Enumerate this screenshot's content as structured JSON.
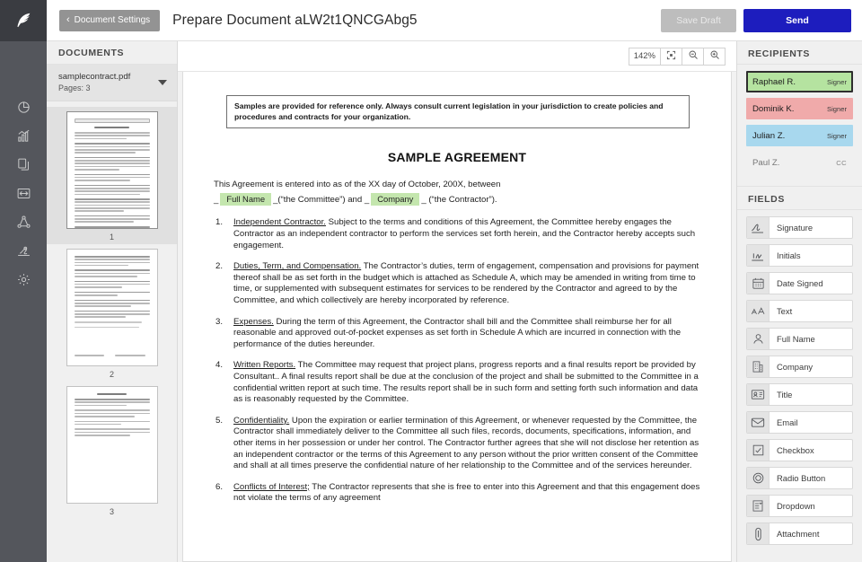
{
  "topbar": {
    "logo_icon": "feather-quill-logo",
    "back_label": "Document Settings",
    "back_chevron": "‹",
    "title": "Prepare Document aLW2t1QNCGAbg5",
    "save_draft_label": "Save Draft",
    "send_label": "Send",
    "send_color": "#1d1dbe",
    "save_draft_color": "#bdbdbd"
  },
  "rail": {
    "items": [
      {
        "name": "pie-chart-icon"
      },
      {
        "name": "bar-chart-icon"
      },
      {
        "name": "documents-icon"
      },
      {
        "name": "templates-icon"
      },
      {
        "name": "network-share-icon"
      },
      {
        "name": "signature-stamp-icon"
      },
      {
        "name": "settings-gear-icon"
      }
    ]
  },
  "documents": {
    "header": "DOCUMENTS",
    "file_name": "samplecontract.pdf",
    "pages_label": "Pages: 3",
    "caret_icon": "chevron-down-icon",
    "thumbnails": [
      {
        "number": "1",
        "selected": true
      },
      {
        "number": "2",
        "selected": false
      },
      {
        "number": "3",
        "selected": false
      }
    ]
  },
  "viewer": {
    "zoom_percent": "142%",
    "fit_icon": "fit-to-screen-icon",
    "zoom_out_icon": "zoom-out-icon",
    "zoom_in_icon": "zoom-in-icon"
  },
  "document": {
    "notice": "Samples are provided for reference only.  Always consult current legislation in your jurisdiction to create policies and procedures and contracts for your organization.",
    "title": "SAMPLE AGREEMENT",
    "intro_line1": "This Agreement is entered into as of the XX day of October, 200X, between",
    "intro_prefix": "_",
    "field_full_name": "Full Name",
    "intro_mid": "_(“the Committee”) and _",
    "field_company": "Company",
    "intro_suffix": "_ (“the Contractor”).",
    "field_color": "#c4e6ae",
    "clauses": [
      {
        "num": "1.",
        "heading": "Independent Contractor.",
        "body": "  Subject to the terms and conditions of this Agreement, the Committee hereby engages the Contractor as an independent contractor to perform the services set forth herein, and the Contractor hereby accepts such engagement."
      },
      {
        "num": "2.",
        "heading": "Duties, Term, and Compensation.",
        "body": "  The Contractor’s duties, term of engagement, compensation and provisions for payment thereof shall be as set forth in the budget which is attached as Schedule A, which may be amended in writing from time to time, or supplemented with subsequent estimates for services to be rendered by the Contractor and agreed to by the Committee, and which collectively are hereby incorporated by reference."
      },
      {
        "num": "3.",
        "heading": "Expenses.",
        "body": "  During the term of this Agreement, the Contractor shall bill and the Committee shall reimburse her for all reasonable and approved out-of-pocket expenses as set forth in Schedule A which are incurred in connection with the performance of the duties hereunder."
      },
      {
        "num": "4.",
        "heading": "Written Reports.",
        "body": "  The Committee may request that project plans, progress reports and a final results report be provided by Consultant..  A final results report shall be due at the conclusion of the project and shall be submitted to the Committee in a confidential written report at such time. The results report shall be in such form and setting forth such information and data as is reasonably requested by the Committee."
      },
      {
        "num": "5.",
        "heading": "Confidentiality.",
        "body": "  Upon the expiration or earlier termination of this Agreement, or whenever requested by the Committee, the Contractor shall immediately deliver to the Committee all such files, records, documents, specifications, information, and other items in her possession or under her control.  The Contractor further agrees that she will not disclose her retention as an independent contractor or the terms of this Agreement to any person without the prior written consent of the Committee and shall at all times preserve the confidential nature of her relationship to the Committee and of the services hereunder."
      },
      {
        "num": "6.",
        "heading": "Conflicts of Interest;",
        "body": " The Contractor represents that she is free to enter into this Agreement and that this engagement does not violate the terms of any agreement"
      }
    ]
  },
  "recipients": {
    "header": "RECIPIENTS",
    "items": [
      {
        "name": "Raphael R.",
        "role": "Signer",
        "color": "#b5e3a0",
        "selected": true
      },
      {
        "name": "Dominik K.",
        "role": "Signer",
        "color": "#f0aaaa",
        "selected": false
      },
      {
        "name": "Julian Z.",
        "role": "Signer",
        "color": "#a8d8ee",
        "selected": false
      },
      {
        "name": "Paul Z.",
        "role": "CC",
        "color": "transparent",
        "selected": false
      }
    ]
  },
  "fields": {
    "header": "FIELDS",
    "items": [
      {
        "label": "Signature",
        "icon": "signature-icon"
      },
      {
        "label": "Initials",
        "icon": "initials-icon"
      },
      {
        "label": "Date Signed",
        "icon": "calendar-icon"
      },
      {
        "label": "Text",
        "icon": "text-icon"
      },
      {
        "label": "Full Name",
        "icon": "person-icon"
      },
      {
        "label": "Company",
        "icon": "building-icon"
      },
      {
        "label": "Title",
        "icon": "id-card-icon"
      },
      {
        "label": "Email",
        "icon": "envelope-icon"
      },
      {
        "label": "Checkbox",
        "icon": "checkbox-icon"
      },
      {
        "label": "Radio Button",
        "icon": "radio-button-icon"
      },
      {
        "label": "Dropdown",
        "icon": "dropdown-icon"
      },
      {
        "label": "Attachment",
        "icon": "paperclip-icon"
      }
    ]
  }
}
